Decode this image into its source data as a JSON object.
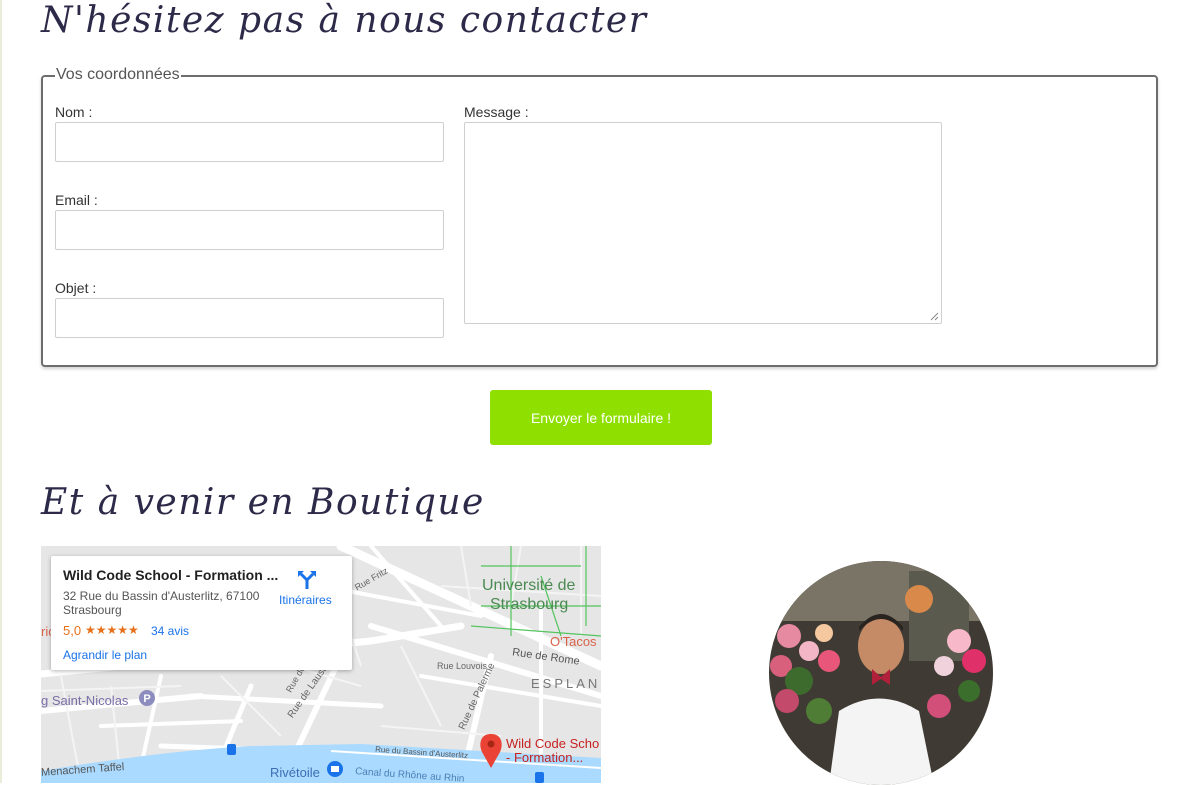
{
  "contact": {
    "title": "N'hésitez pas à nous contacter",
    "legend": "Vos coordonnées",
    "fields": {
      "nom_label": "Nom :",
      "email_label": "Email :",
      "objet_label": "Objet :",
      "message_label": "Message :"
    },
    "submit_label": "Envoyer le formulaire !"
  },
  "shop": {
    "title": "Et à venir en Boutique"
  },
  "map": {
    "place_name": "Wild Code School - Formation ...",
    "address_line1": "32 Rue du Bassin d'Austerlitz, 67100",
    "address_line2": "Strasbourg",
    "rating": "5,0",
    "stars": "★★★★★",
    "reviews": "34 avis",
    "enlarge_link": "Agrandir le plan",
    "directions_label": "Itinéraires",
    "labels": {
      "universite_1": "Université de",
      "universite_2": "Strasbourg",
      "otacos": "O'Tacos",
      "rue_de_rome": "Rue de Rome",
      "esplan": "ESPLAN",
      "saint_nicolas": "g Saint-Nicolas",
      "rue_fritz": "Rue Fritz",
      "rue_louvois": "Rue Louvois",
      "rue_de_lausanne": "Rue de Lausa",
      "rue_de_palerme": "Rue de Palerme",
      "rue_de": "Rue de",
      "rue_du_bassin": "Rue du Bassin d'Austerlitz",
      "rue_bassin_short": "Rue du Bassin d'Austerlitz",
      "canal": "Canal du Rhône au Rhin",
      "rivetoile": "Rivétoile",
      "menachem": "Menachem Taffel",
      "pin_label_1": "Wild Code Scho",
      "pin_label_2": "- Formation...",
      "left_ric": "ric"
    },
    "colors": {
      "road": "#ffffff",
      "block": "#e6e6e6",
      "water": "#aadaff",
      "park_line": "#53c45e",
      "pin": "#ea4335",
      "link": "#1a73e8"
    }
  },
  "colors": {
    "title": "#2c2a48",
    "submit_bg": "#8fe000",
    "border": "#6d6d6d"
  }
}
